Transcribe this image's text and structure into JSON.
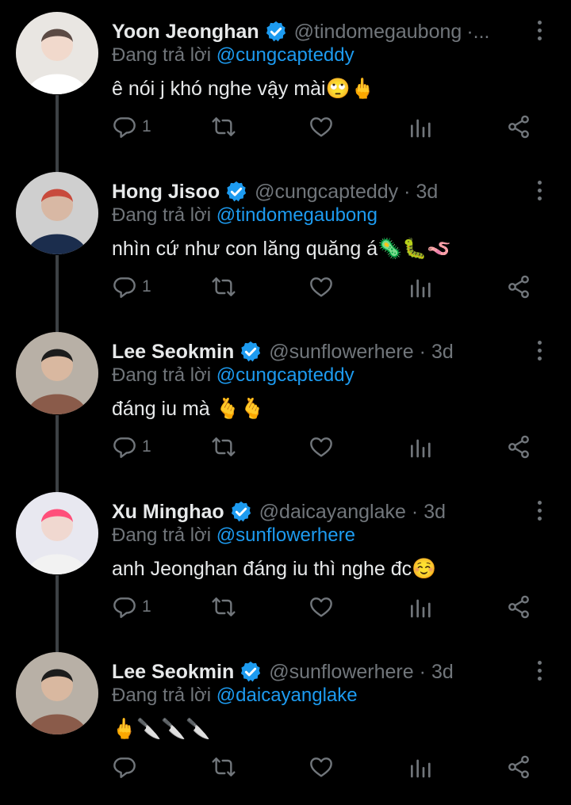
{
  "colors": {
    "background": "#000000",
    "text": "#e7e9ea",
    "muted": "#71767b",
    "link": "#1d9bf0",
    "verified": "#1d9bf0"
  },
  "reply_prefix": "Đang trả lời",
  "tweets": [
    {
      "name": "Yoon Jeonghan",
      "handle": "@tindomegaubong",
      "time": "",
      "header_suffix": "·...",
      "reply_to": "@cungcapteddy",
      "text": "ê nói j khó nghe vậy mài🙄🖕",
      "reply_count": "1"
    },
    {
      "name": "Hong Jisoo",
      "handle": "@cungcapteddy",
      "time": "3d",
      "header_suffix": "",
      "reply_to": "@tindomegaubong",
      "text": "nhìn cứ như con lăng quăng á🦠🐛🪱",
      "reply_count": "1"
    },
    {
      "name": "Lee Seokmin",
      "handle": "@sunflowerhere",
      "time": "3d",
      "header_suffix": "",
      "reply_to": "@cungcapteddy",
      "text": "đáng iu mà 🫰🫰",
      "reply_count": "1"
    },
    {
      "name": "Xu Minghao",
      "handle": "@daicayanglake",
      "time": "3d",
      "header_suffix": "",
      "reply_to": "@sunflowerhere",
      "text": "anh Jeonghan đáng iu thì nghe đc☺️",
      "reply_count": "1"
    },
    {
      "name": "Lee Seokmin",
      "handle": "@sunflowerhere",
      "time": "3d",
      "header_suffix": "",
      "reply_to": "@daicayanglake",
      "text": "🖕🔪🔪🔪",
      "reply_count": ""
    }
  ],
  "icons": {
    "reply": "reply-icon",
    "retweet": "retweet-icon",
    "like": "heart-icon",
    "views": "views-icon",
    "share": "share-icon",
    "verified": "verified-badge-icon",
    "more": "more-options-icon"
  }
}
